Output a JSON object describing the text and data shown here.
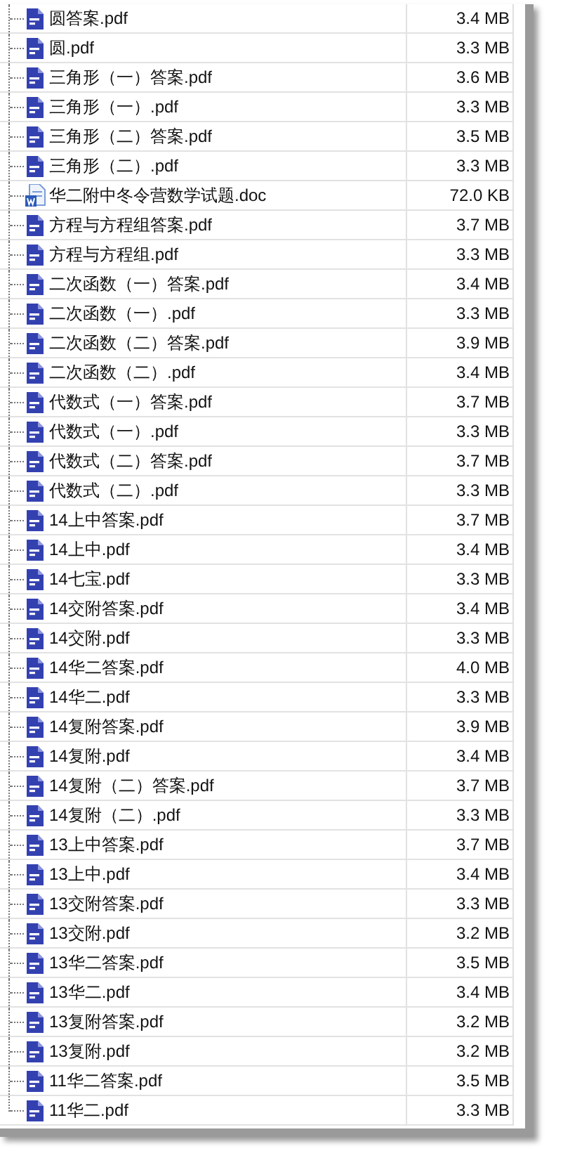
{
  "files": [
    {
      "name": "圆答案.pdf",
      "size": "3.4 MB",
      "kind": "pdf"
    },
    {
      "name": "圆.pdf",
      "size": "3.3 MB",
      "kind": "pdf"
    },
    {
      "name": "三角形（一）答案.pdf",
      "size": "3.6 MB",
      "kind": "pdf"
    },
    {
      "name": "三角形（一）.pdf",
      "size": "3.3 MB",
      "kind": "pdf"
    },
    {
      "name": "三角形（二）答案.pdf",
      "size": "3.5 MB",
      "kind": "pdf"
    },
    {
      "name": "三角形（二）.pdf",
      "size": "3.3 MB",
      "kind": "pdf"
    },
    {
      "name": "华二附中冬令营数学试题.doc",
      "size": "72.0 KB",
      "kind": "doc"
    },
    {
      "name": "方程与方程组答案.pdf",
      "size": "3.7 MB",
      "kind": "pdf"
    },
    {
      "name": "方程与方程组.pdf",
      "size": "3.3 MB",
      "kind": "pdf"
    },
    {
      "name": "二次函数（一）答案.pdf",
      "size": "3.4 MB",
      "kind": "pdf"
    },
    {
      "name": "二次函数（一）.pdf",
      "size": "3.3 MB",
      "kind": "pdf"
    },
    {
      "name": "二次函数（二）答案.pdf",
      "size": "3.9 MB",
      "kind": "pdf"
    },
    {
      "name": "二次函数（二）.pdf",
      "size": "3.4 MB",
      "kind": "pdf"
    },
    {
      "name": "代数式（一）答案.pdf",
      "size": "3.7 MB",
      "kind": "pdf"
    },
    {
      "name": "代数式（一）.pdf",
      "size": "3.3 MB",
      "kind": "pdf"
    },
    {
      "name": "代数式（二）答案.pdf",
      "size": "3.7 MB",
      "kind": "pdf"
    },
    {
      "name": "代数式（二）.pdf",
      "size": "3.3 MB",
      "kind": "pdf"
    },
    {
      "name": "14上中答案.pdf",
      "size": "3.7 MB",
      "kind": "pdf"
    },
    {
      "name": "14上中.pdf",
      "size": "3.4 MB",
      "kind": "pdf"
    },
    {
      "name": "14七宝.pdf",
      "size": "3.3 MB",
      "kind": "pdf"
    },
    {
      "name": "14交附答案.pdf",
      "size": "3.4 MB",
      "kind": "pdf"
    },
    {
      "name": "14交附.pdf",
      "size": "3.3 MB",
      "kind": "pdf"
    },
    {
      "name": "14华二答案.pdf",
      "size": "4.0 MB",
      "kind": "pdf"
    },
    {
      "name": "14华二.pdf",
      "size": "3.3 MB",
      "kind": "pdf"
    },
    {
      "name": "14复附答案.pdf",
      "size": "3.9 MB",
      "kind": "pdf"
    },
    {
      "name": "14复附.pdf",
      "size": "3.4 MB",
      "kind": "pdf"
    },
    {
      "name": "14复附（二）答案.pdf",
      "size": "3.7 MB",
      "kind": "pdf"
    },
    {
      "name": "14复附（二）.pdf",
      "size": "3.3 MB",
      "kind": "pdf"
    },
    {
      "name": "13上中答案.pdf",
      "size": "3.7 MB",
      "kind": "pdf"
    },
    {
      "name": "13上中.pdf",
      "size": "3.4 MB",
      "kind": "pdf"
    },
    {
      "name": "13交附答案.pdf",
      "size": "3.3 MB",
      "kind": "pdf"
    },
    {
      "name": "13交附.pdf",
      "size": "3.2 MB",
      "kind": "pdf"
    },
    {
      "name": "13华二答案.pdf",
      "size": "3.5 MB",
      "kind": "pdf"
    },
    {
      "name": "13华二.pdf",
      "size": "3.4 MB",
      "kind": "pdf"
    },
    {
      "name": "13复附答案.pdf",
      "size": "3.2 MB",
      "kind": "pdf"
    },
    {
      "name": "13复附.pdf",
      "size": "3.2 MB",
      "kind": "pdf"
    },
    {
      "name": "11华二答案.pdf",
      "size": "3.5 MB",
      "kind": "pdf"
    },
    {
      "name": "11华二.pdf",
      "size": "3.3 MB",
      "kind": "pdf"
    }
  ]
}
